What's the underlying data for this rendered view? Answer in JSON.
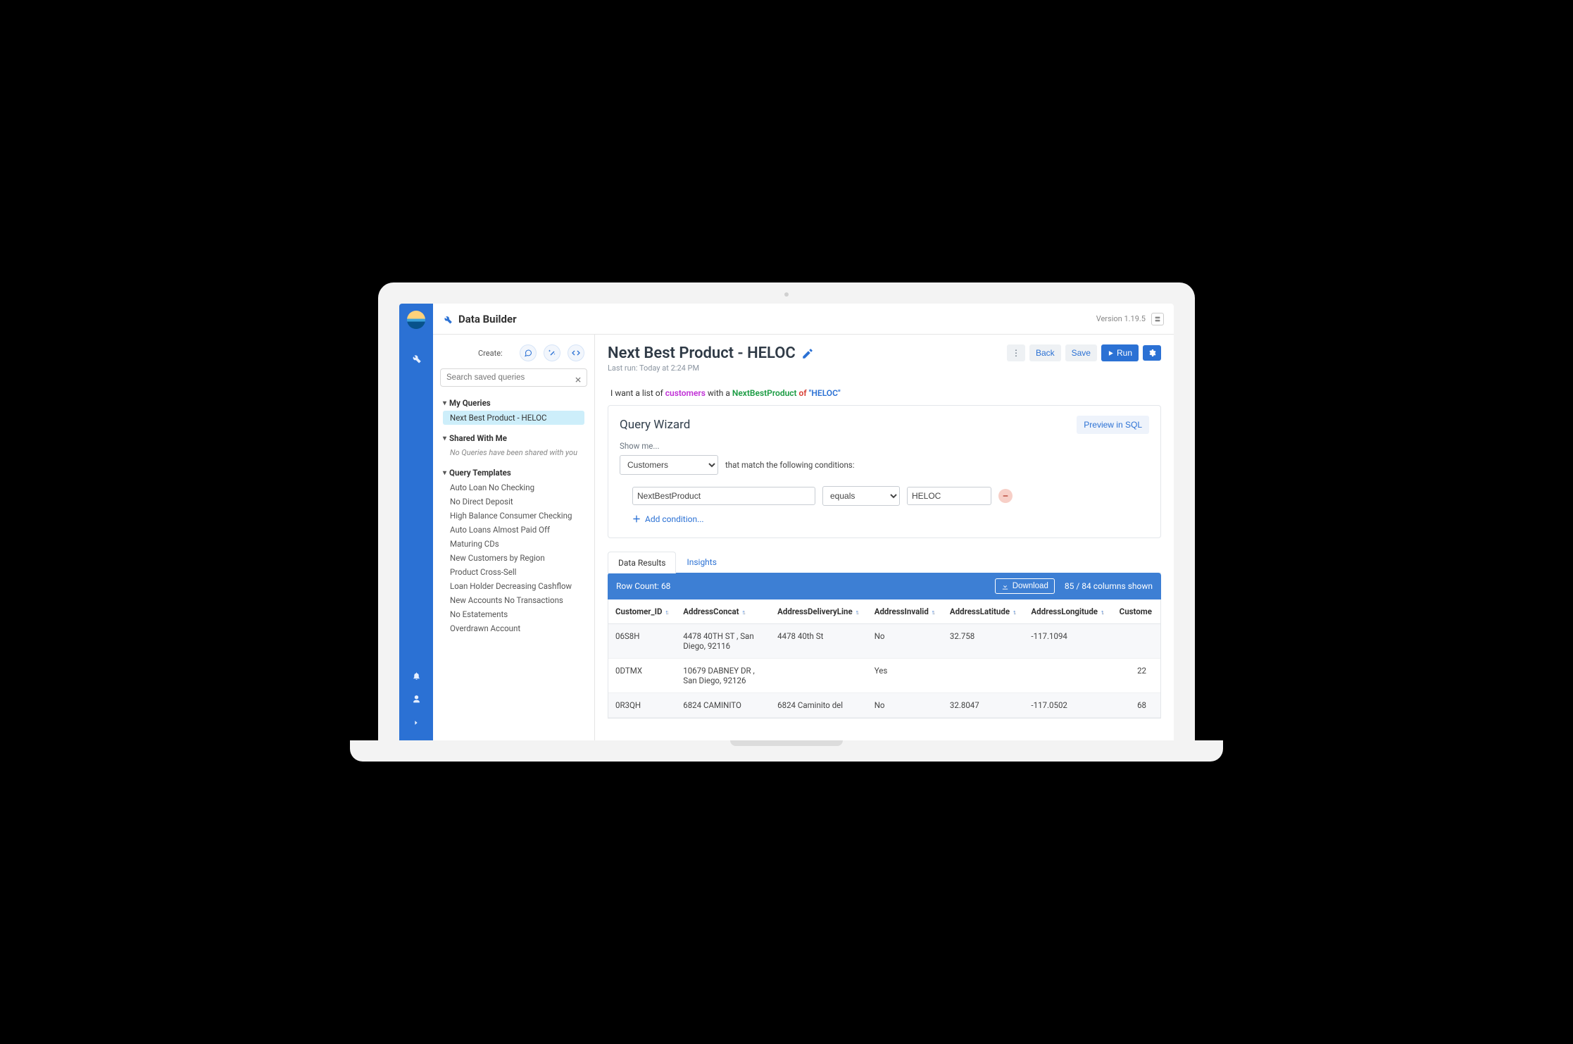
{
  "header": {
    "title": "Data Builder",
    "version": "Version 1.19.5"
  },
  "sidebar": {
    "create_label": "Create:",
    "search_placeholder": "Search saved queries",
    "sections": {
      "my_queries": {
        "title": "My Queries",
        "items": [
          "Next Best Product - HELOC"
        ]
      },
      "shared": {
        "title": "Shared With Me",
        "empty": "No Queries have been shared with you"
      },
      "templates": {
        "title": "Query Templates",
        "items": [
          "Auto Loan No Checking",
          "No Direct Deposit",
          "High Balance Consumer Checking",
          "Auto Loans Almost Paid Off",
          "Maturing CDs",
          "New Customers by Region",
          "Product Cross-Sell",
          "Loan Holder Decreasing Cashflow",
          "New Accounts No Transactions",
          "No Estatements",
          "Overdrawn Account"
        ]
      }
    }
  },
  "page": {
    "title": "Next Best Product - HELOC",
    "last_run": "Last run: Today at 2:24 PM",
    "actions": {
      "back": "Back",
      "save": "Save",
      "run": "Run"
    }
  },
  "sentence": {
    "prefix": "I want a list of ",
    "entity": "customers",
    "with": " with a ",
    "field": "NextBestProduct",
    "of": " of ",
    "value": "\"HELOC\""
  },
  "wizard": {
    "title": "Query Wizard",
    "preview": "Preview in SQL",
    "show_me": "Show me...",
    "entity_select": "Customers",
    "match_text": "that match the following conditions:",
    "condition": {
      "field": "NextBestProduct",
      "operator": "equals",
      "value": "HELOC"
    },
    "add_condition": "Add condition..."
  },
  "tabs": {
    "data": "Data Results",
    "insights": "Insights"
  },
  "results": {
    "row_count_label": "Row Count: 68",
    "download": "Download",
    "columns_label": "85 / 84 columns shown",
    "columns": [
      "Customer_ID",
      "AddressConcat",
      "AddressDeliveryLine",
      "AddressInvalid",
      "AddressLatitude",
      "AddressLongitude",
      "Custome"
    ],
    "rows": [
      {
        "id": "06S8H",
        "concat": "4478 40TH ST , San Diego, 92116",
        "delivery": "4478 40th St",
        "invalid": "No",
        "lat": "32.758",
        "lon": "-117.1094",
        "last": ""
      },
      {
        "id": "0DTMX",
        "concat": "10679 DABNEY DR , San Diego, 92126",
        "delivery": "",
        "invalid": "Yes",
        "lat": "",
        "lon": "",
        "last": "22"
      },
      {
        "id": "0R3QH",
        "concat": "6824 CAMINITO",
        "delivery": "6824 Caminito del",
        "invalid": "No",
        "lat": "32.8047",
        "lon": "-117.0502",
        "last": "68"
      }
    ]
  }
}
